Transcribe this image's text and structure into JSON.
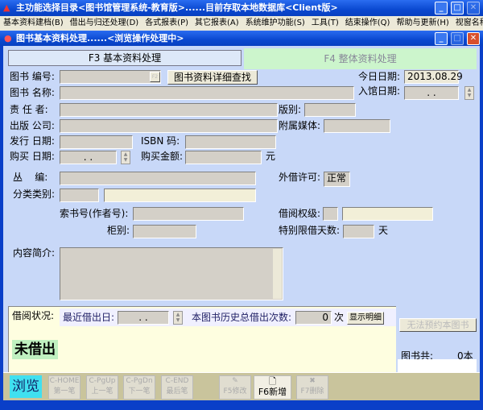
{
  "outer_window": {
    "title": "主功能选择目录<图书馆管理系统-教育版>......目前存取本地数据库<Client版>"
  },
  "menu": [
    "基本资料建档(B)",
    "借出与归还处理(D)",
    "各式报表(P)",
    "其它报表(A)",
    "系统维护功能(S)",
    "工具(T)",
    "结束操作(Q)",
    "帮助与更新(H)",
    "视窗名称(W)"
  ],
  "inner_window": {
    "title": "图书基本资料处理......<浏览操作处理中>"
  },
  "tabs": {
    "f3": "F3 基本资料处理",
    "f4": "F4 整体资料处理"
  },
  "form": {
    "book_no": "图书 编号:",
    "f2": "F2",
    "search_btn": "图书资料详细查找",
    "today_label": "今日日期:",
    "today": "2013.08.29",
    "title": "图书 名称:",
    "entry_date": "入馆日期:",
    "entry_date_value": ". .",
    "author": "责 任 者:",
    "edition": "版别:",
    "publisher": "出版 公司:",
    "media": "附属媒体:",
    "pub_date": "发行 日期:",
    "isbn": "ISBN 码:",
    "buy_date": "购买 日期:",
    "buy_date_value": ". .",
    "amount": "购买金额:",
    "yuan": "元",
    "series": "丛    编:",
    "lend_permit": "外借许可:",
    "lend_permit_value": "正常",
    "category": "分类类别:",
    "call_no": "索书号(作者号):",
    "borrow_level": "借阅权级:",
    "cabinet": "柜别:",
    "limit_days": "特别限借天数:",
    "day": "天",
    "summary": "内容简介:"
  },
  "borrow": {
    "label": "借阅状况:",
    "last_date": "最近借出日:",
    "last_date_value": ". .",
    "total": "本图书历史总借出次数:",
    "count": "0",
    "times": "次",
    "detail_btn": "显示明细",
    "status": "未借出"
  },
  "reserve_btn": "无法预约本图书",
  "book_count": {
    "label": "图书共:",
    "value": "0本"
  },
  "toolbar": {
    "mode": "浏览",
    "first": [
      "C-HOME",
      "第一笔"
    ],
    "prev": [
      "C-PgUp",
      "上一笔"
    ],
    "next": [
      "C-PgDn",
      "下一笔"
    ],
    "last": [
      "C-END",
      "最后笔"
    ],
    "edit": "F5修改",
    "add": "F6新增",
    "del": "F7删除"
  }
}
